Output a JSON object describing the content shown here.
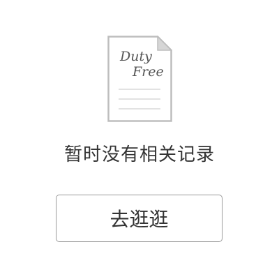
{
  "empty_state": {
    "logo_line_1": "Duty",
    "logo_line_2": "Free",
    "message": "暂时没有相关记录",
    "action_label": "去逛逛"
  },
  "colors": {
    "border": "#9a9a9a",
    "text": "#333333",
    "background": "#ffffff",
    "page_fold": "#d6d6d6"
  },
  "icons": [
    "document-icon"
  ]
}
